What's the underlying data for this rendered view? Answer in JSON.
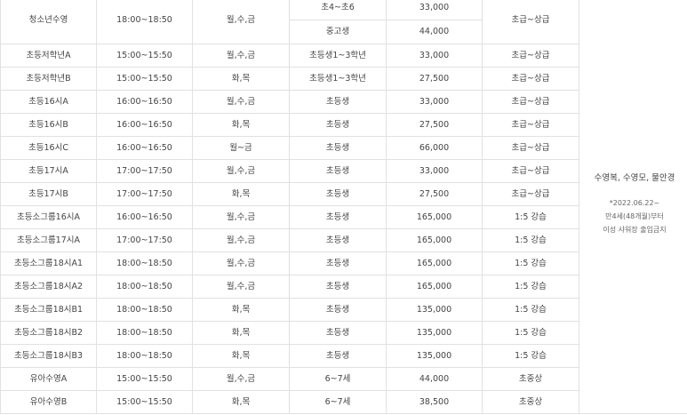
{
  "rows": [
    {
      "name": "청소년수영",
      "time": "18:00~18:50",
      "days": "월,수,금",
      "target": "초4~초6",
      "price": "33,000",
      "level": "초급~상급"
    },
    {
      "name": "",
      "time": "",
      "days": "",
      "target": "중고생",
      "price": "44,000",
      "level": ""
    },
    {
      "name": "초등저학년A",
      "time": "15:00~15:50",
      "days": "월,수,금",
      "target": "초등생1~3학년",
      "price": "33,000",
      "level": "초급~상급"
    },
    {
      "name": "초등저학년B",
      "time": "15:00~15:50",
      "days": "화,목",
      "target": "초등생1~3학년",
      "price": "27,500",
      "level": "초급~상급"
    },
    {
      "name": "초등16시A",
      "time": "16:00~16:50",
      "days": "월,수,금",
      "target": "초등생",
      "price": "33,000",
      "level": "초급~상급"
    },
    {
      "name": "초등16시B",
      "time": "16:00~16:50",
      "days": "화,목",
      "target": "초등생",
      "price": "27,500",
      "level": "초급~상급"
    },
    {
      "name": "초등16시C",
      "time": "16:00~16:50",
      "days": "월~금",
      "target": "초등생",
      "price": "66,000",
      "level": "초급~상급"
    },
    {
      "name": "초등17시A",
      "time": "17:00~17:50",
      "days": "월,수,금",
      "target": "초등생",
      "price": "33,000",
      "level": "초급~상급"
    },
    {
      "name": "초등17시B",
      "time": "17:00~17:50",
      "days": "화,목",
      "target": "초등생",
      "price": "27,500",
      "level": "초급~상급"
    },
    {
      "name": "초등소그룹16시A",
      "time": "16:00~16:50",
      "days": "월,수,금",
      "target": "초등생",
      "price": "165,000",
      "level": "1:5 강습"
    },
    {
      "name": "초등소그룹17시A",
      "time": "17:00~17:50",
      "days": "월,수,금",
      "target": "초등생",
      "price": "165,000",
      "level": "1:5 강습"
    },
    {
      "name": "초등소그룹18시A1",
      "time": "18:00~18:50",
      "days": "월,수,금",
      "target": "초등생",
      "price": "165,000",
      "level": "1:5 강습"
    },
    {
      "name": "초등소그룹18시A2",
      "time": "18:00~18:50",
      "days": "월,수,금",
      "target": "초등생",
      "price": "165,000",
      "level": "1:5 강습"
    },
    {
      "name": "초등소그룹18시B1",
      "time": "18:00~18:50",
      "days": "화,목",
      "target": "초등생",
      "price": "135,000",
      "level": "1:5 강습"
    },
    {
      "name": "초등소그룹18시B2",
      "time": "18:00~18:50",
      "days": "화,목",
      "target": "초등생",
      "price": "135,000",
      "level": "1:5 강습"
    },
    {
      "name": "초등소그룹18시B3",
      "time": "18:00~18:50",
      "days": "화,목",
      "target": "초등생",
      "price": "135,000",
      "level": "1:5 강습"
    },
    {
      "name": "유아수영A",
      "time": "15:00~15:50",
      "days": "월,수,금",
      "target": "6~7세",
      "price": "44,000",
      "level": "초중상"
    },
    {
      "name": "유아수영B",
      "time": "15:00~15:50",
      "days": "화,목",
      "target": "6~7세",
      "price": "38,500",
      "level": "초중상"
    }
  ],
  "note": {
    "main": "수영복, 수영모, 물안경",
    "line1": "*2022.06.22~",
    "line2": "만4세(48개월)부터",
    "line3": "이성 샤워장 출입금지"
  }
}
